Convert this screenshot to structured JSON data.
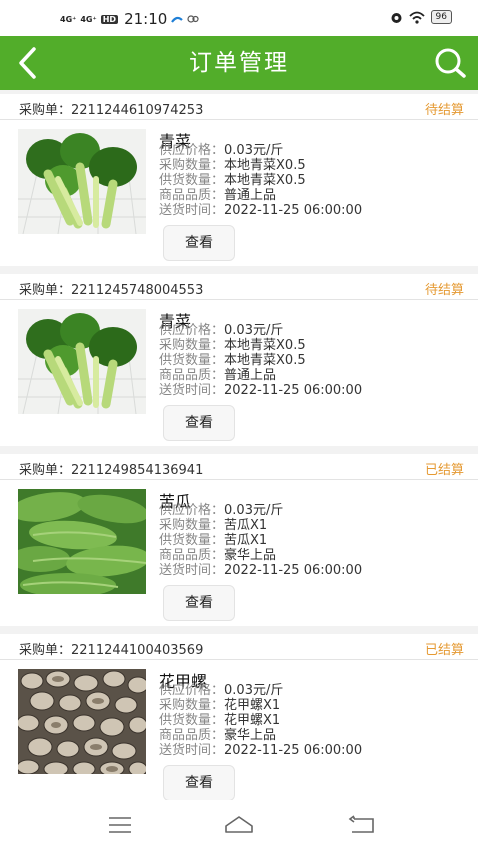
{
  "status_bar": {
    "signal1": "4G⁺",
    "signal2": "4G⁺",
    "hd": "HD",
    "time": "21:10",
    "battery": "96"
  },
  "header": {
    "title": "订单管理",
    "back_icon": "chevron-left-icon",
    "search_icon": "search-icon"
  },
  "labels": {
    "order_no": "采购单：",
    "price": "供应价格：",
    "purchase_qty": "采购数量：",
    "supply_qty": "供货数量：",
    "quality": "商品品质：",
    "delivery": "送货时间：",
    "view_button": "查看"
  },
  "orders": [
    {
      "order_no": "2211244610974253",
      "status": "待结算",
      "name": "青菜",
      "price": "0.03元/斤",
      "purchase_qty": "本地青菜X0.5",
      "supply_qty": "本地青菜X0.5",
      "quality": "普通上品",
      "delivery": "2022-11-25 06:00:00",
      "image": "bok-choy-photo"
    },
    {
      "order_no": "2211245748004553",
      "status": "待结算",
      "name": "青菜",
      "price": "0.03元/斤",
      "purchase_qty": "本地青菜X0.5",
      "supply_qty": "本地青菜X0.5",
      "quality": "普通上品",
      "delivery": "2022-11-25 06:00:00",
      "image": "bok-choy-photo"
    },
    {
      "order_no": "2211249854136941",
      "status": "已结算",
      "name": "苦瓜",
      "price": "0.03元/斤",
      "purchase_qty": "苦瓜X1",
      "supply_qty": "苦瓜X1",
      "quality": "豪华上品",
      "delivery": "2022-11-25 06:00:00",
      "image": "bitter-melon-photo"
    },
    {
      "order_no": "2211244100403569",
      "status": "已结算",
      "name": "花甲螺",
      "price": "0.03元/斤",
      "purchase_qty": "花甲螺X1",
      "supply_qty": "花甲螺X1",
      "quality": "豪华上品",
      "delivery": "2022-11-25 06:00:00",
      "image": "clams-photo"
    }
  ],
  "colors": {
    "brand": "#52ad2a",
    "status_pending": "#e59a33",
    "status_settled": "#e59a33"
  },
  "nav": {
    "menu_icon": "menu-icon",
    "home_icon": "home-icon",
    "back_icon": "back-icon"
  }
}
